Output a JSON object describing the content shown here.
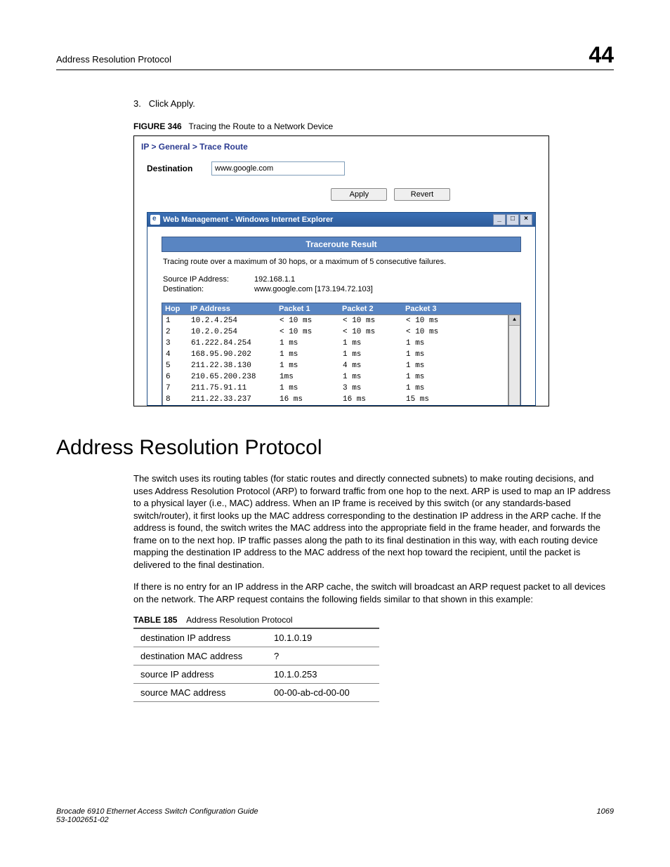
{
  "header": {
    "left": "Address Resolution Protocol",
    "right": "44"
  },
  "step": {
    "num": "3.",
    "text": "Click Apply."
  },
  "figure": {
    "label": "FIGURE 346",
    "title": "Tracing the Route to a Network Device",
    "breadcrumb": "IP > General > Trace Route",
    "dest_label": "Destination",
    "dest_value": "www.google.com",
    "apply_label": "Apply",
    "revert_label": "Revert",
    "popup_title": "Web Management - Windows Internet Explorer",
    "tr_header": "Traceroute Result",
    "tracing_note": "Tracing route over a maximum of 30 hops, or a maximum of 5 consecutive failures.",
    "source_ip_label": "Source IP Address:",
    "source_ip_value": "192.168.1.1",
    "dest2_label": "Destination:",
    "dest2_value": "www.google.com [173.194.72.103]",
    "cols": {
      "hop": "Hop",
      "ip": "IP Address",
      "p1": "Packet 1",
      "p2": "Packet 2",
      "p3": "Packet 3"
    },
    "hops": [
      {
        "n": "1",
        "ip": "10.2.4.254",
        "p1": "< 10 ms",
        "p2": "< 10 ms",
        "p3": "< 10 ms"
      },
      {
        "n": "2",
        "ip": "10.2.0.254",
        "p1": "< 10 ms",
        "p2": "< 10 ms",
        "p3": "< 10 ms"
      },
      {
        "n": "3",
        "ip": "61.222.84.254",
        "p1": "1 ms",
        "p2": "1 ms",
        "p3": "1 ms"
      },
      {
        "n": "4",
        "ip": "168.95.90.202",
        "p1": "1 ms",
        "p2": "1 ms",
        "p3": "1 ms"
      },
      {
        "n": "5",
        "ip": "211.22.38.130",
        "p1": "1 ms",
        "p2": "4 ms",
        "p3": "1 ms"
      },
      {
        "n": "6",
        "ip": "210.65.200.238",
        "p1": "1ms",
        "p2": "1 ms",
        "p3": "1 ms"
      },
      {
        "n": "7",
        "ip": "211.75.91.11",
        "p1": "1 ms",
        "p2": "3 ms",
        "p3": "1 ms"
      },
      {
        "n": "8",
        "ip": "211.22.33.237",
        "p1": "16 ms",
        "p2": "16 ms",
        "p3": "15 ms"
      }
    ]
  },
  "section_title": "Address Resolution Protocol",
  "para1": "The switch uses its routing tables (for static routes and directly connected subnets) to make routing decisions, and uses Address Resolution Protocol (ARP) to forward traffic from one hop to the next. ARP is used to map an IP address to a physical layer (i.e., MAC) address. When an IP frame is received by this switch (or any standards-based switch/router), it first looks up the MAC address corresponding to the destination IP address in the ARP cache. If the address is found, the switch writes the MAC address into the appropriate field in the frame header, and forwards the frame on to the next hop. IP traffic passes along the path to its final destination in this way, with each routing device mapping the destination IP address to the MAC address of the next hop toward the recipient, until the packet is delivered to the final destination.",
  "para2": "If there is no entry for an IP address in the ARP cache, the switch will broadcast an ARP request packet to all devices on the network. The ARP request contains the following fields similar to that shown in this example:",
  "table": {
    "label": "TABLE 185",
    "title": "Address Resolution Protocol",
    "rows": [
      {
        "k": "destination IP address",
        "v": "10.1.0.19"
      },
      {
        "k": "destination MAC address",
        "v": "?"
      },
      {
        "k": "source IP address",
        "v": "10.1.0.253"
      },
      {
        "k": "source MAC address",
        "v": "00-00-ab-cd-00-00"
      }
    ]
  },
  "footer": {
    "left1": "Brocade 6910 Ethernet Access Switch Configuration Guide",
    "left2": "53-1002651-02",
    "right": "1069"
  }
}
